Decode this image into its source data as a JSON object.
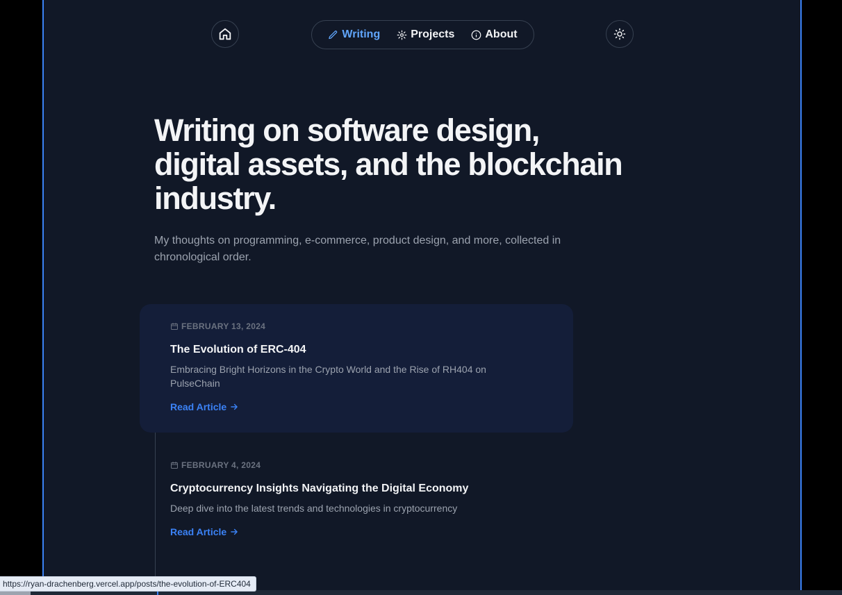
{
  "nav": {
    "items": [
      {
        "label": "Writing",
        "icon": "pencil-icon",
        "active": true
      },
      {
        "label": "Projects",
        "icon": "gear-icon",
        "active": false
      },
      {
        "label": "About",
        "icon": "info-icon",
        "active": false
      }
    ],
    "home_icon": "home-icon",
    "theme_icon": "sun-icon"
  },
  "hero": {
    "headline": "Writing on software design, digital assets, and the blockchain industry.",
    "intro": "My thoughts on programming, e-commerce, product design, and more, collected in chronological order."
  },
  "posts": [
    {
      "date": "FEBRUARY 13, 2024",
      "title": "The Evolution of ERC-404",
      "summary": "Embracing Bright Horizons in the Crypto World and the Rise of RH404 on PulseChain",
      "link_label": "Read Article"
    },
    {
      "date": "FEBRUARY 4, 2024",
      "title": "Cryptocurrency Insights Navigating the Digital Economy",
      "summary": "Deep dive into the latest trends and technologies in cryptocurrency",
      "link_label": "Read Article"
    }
  ],
  "status_bar": {
    "url": "https://ryan-drachenberg.vercel.app/posts/the-evolution-of-ERC404"
  },
  "colors": {
    "background": "#111827",
    "accent": "#3b82f6",
    "active_nav": "#60a5fa",
    "highlight_card": "#141e39",
    "text_primary": "#f3f4f6",
    "text_muted": "#9ca3af"
  }
}
